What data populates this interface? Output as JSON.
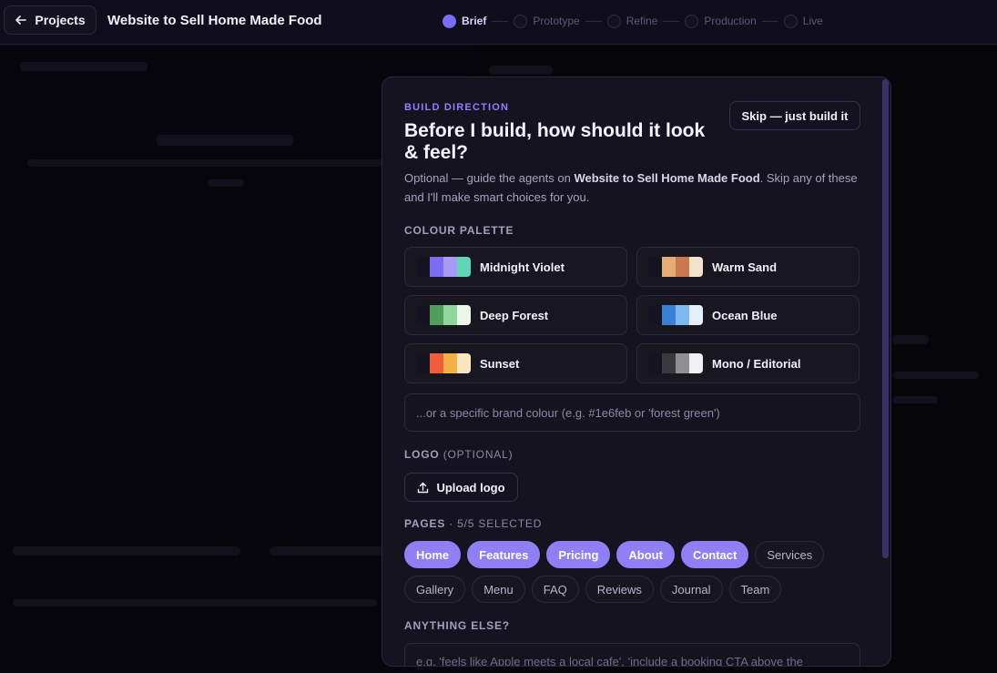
{
  "topbar": {
    "back_label": "Projects",
    "project_title": "Website to Sell Home Made Food",
    "steps": [
      {
        "label": "Brief",
        "active": true
      },
      {
        "label": "Prototype",
        "active": false
      },
      {
        "label": "Refine",
        "active": false
      },
      {
        "label": "Production",
        "active": false
      },
      {
        "label": "Live",
        "active": false
      }
    ]
  },
  "modal": {
    "eyebrow": "BUILD DIRECTION",
    "title": "Before I build, how should it look & feel?",
    "skip_label": "Skip — just build it",
    "subtitle_prefix": "Optional — guide the agents on ",
    "subtitle_project": "Website to Sell Home Made Food",
    "subtitle_suffix": ". Skip any of these and I'll make smart choices for you.",
    "palette_label": "COLOUR PALETTE",
    "palettes": [
      {
        "name": "Midnight Violet",
        "colors": [
          "#15131f",
          "#7c6cf4",
          "#a79bf7",
          "#5fd6b8"
        ]
      },
      {
        "name": "Warm Sand",
        "colors": [
          "#15131f",
          "#e5ad74",
          "#c87a4e",
          "#f2e3cc"
        ]
      },
      {
        "name": "Deep Forest",
        "colors": [
          "#15131f",
          "#4f9e5c",
          "#8fd69a",
          "#eaf6ec"
        ]
      },
      {
        "name": "Ocean Blue",
        "colors": [
          "#15131f",
          "#3a7fd6",
          "#7db8ef",
          "#e3f0fb"
        ]
      },
      {
        "name": "Sunset",
        "colors": [
          "#15131f",
          "#ef5e3c",
          "#f5b046",
          "#fbe6c4"
        ]
      },
      {
        "name": "Mono / Editorial",
        "colors": [
          "#15131f",
          "#3a3a3e",
          "#8f8f93",
          "#f0f0f2"
        ]
      }
    ],
    "brand_placeholder": "...or a specific brand colour (e.g. #1e6feb or 'forest green')",
    "logo_label": "LOGO",
    "logo_optional": "(OPTIONAL)",
    "upload_label": "Upload logo",
    "pages_label": "PAGES",
    "pages_count": " · 5/5 SELECTED",
    "pages": [
      {
        "label": "Home",
        "selected": true
      },
      {
        "label": "Features",
        "selected": true
      },
      {
        "label": "Pricing",
        "selected": true
      },
      {
        "label": "About",
        "selected": true
      },
      {
        "label": "Contact",
        "selected": true
      },
      {
        "label": "Services",
        "selected": false
      },
      {
        "label": "Gallery",
        "selected": false
      },
      {
        "label": "Menu",
        "selected": false
      },
      {
        "label": "FAQ",
        "selected": false
      },
      {
        "label": "Reviews",
        "selected": false
      },
      {
        "label": "Journal",
        "selected": false
      },
      {
        "label": "Team",
        "selected": false
      }
    ],
    "else_label": "ANYTHING ELSE?",
    "else_placeholder": "e.g. 'feels like Apple meets a local cafe', 'include a booking CTA above the"
  }
}
